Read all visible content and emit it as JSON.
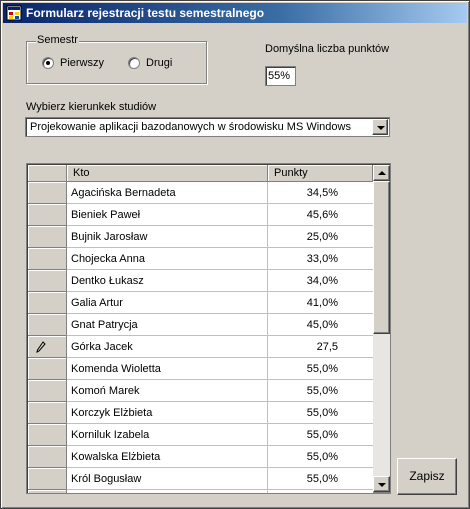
{
  "window": {
    "title": "Formularz rejestracji testu semestralnego",
    "icon": "form-app-icon"
  },
  "semester": {
    "legend": "Semestr",
    "options": [
      {
        "label": "Pierwszy",
        "selected": true
      },
      {
        "label": "Drugi",
        "selected": false
      }
    ]
  },
  "points": {
    "label": "Domyślna liczba punktów",
    "value": "55%"
  },
  "direction": {
    "label": "Wybierz kierunkek studiów",
    "selected": "Projekowanie aplikacji bazodanowych w środowisku MS Windows"
  },
  "table": {
    "columns": [
      "Kto",
      "Punkty"
    ],
    "rows": [
      {
        "name": "Agacińska Bernadeta",
        "points": "34,5%"
      },
      {
        "name": "Bieniek Paweł",
        "points": "45,6%"
      },
      {
        "name": "Bujnik Jarosław",
        "points": "25,0%"
      },
      {
        "name": "Chojecka Anna",
        "points": "33,0%"
      },
      {
        "name": "Dentko Łukasz",
        "points": "34,0%"
      },
      {
        "name": "Galia Artur",
        "points": "41,0%"
      },
      {
        "name": "Gnat Patrycja",
        "points": "45,0%"
      },
      {
        "name": "Górka Jacek",
        "points": "27,5",
        "editing": true
      },
      {
        "name": "Komenda Wioletta",
        "points": "55,0%"
      },
      {
        "name": "Komoń Marek",
        "points": "55,0%"
      },
      {
        "name": "Korczyk Elżbieta",
        "points": "55,0%"
      },
      {
        "name": "Korniluk Izabela",
        "points": "55,0%"
      },
      {
        "name": "Kowalska Elżbieta",
        "points": "55,0%"
      },
      {
        "name": "Król Bogusław",
        "points": "55,0%"
      },
      {
        "name": "",
        "points": ""
      }
    ]
  },
  "save_button": {
    "label": "Zapisz"
  },
  "colors": {
    "titlebar_start": "#0a246a",
    "titlebar_end": "#a6caf0",
    "face": "#d4d0c8"
  }
}
